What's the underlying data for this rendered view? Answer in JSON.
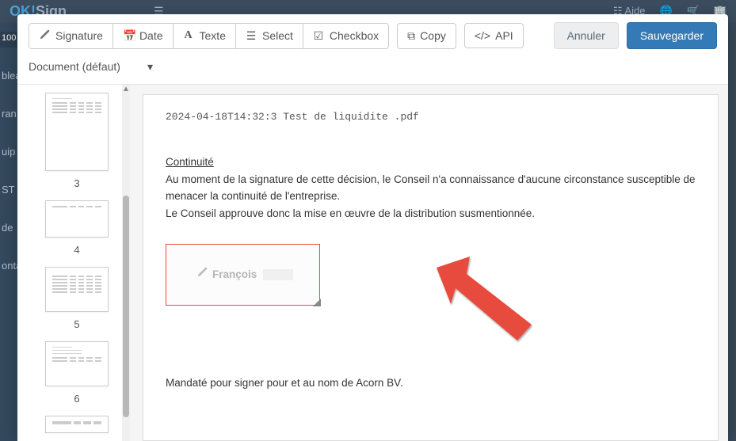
{
  "brand": {
    "ok": "OK!",
    "sign": "Sign"
  },
  "topbar": {
    "aide": "Aide"
  },
  "sidebar": {
    "zoom": "100",
    "items": [
      "blea",
      "ran",
      "uip",
      "ST",
      "de",
      "onta"
    ]
  },
  "toolbar": {
    "signature": "Signature",
    "date": "Date",
    "texte": "Texte",
    "select": "Select",
    "checkbox": "Checkbox",
    "copy": "Copy",
    "api": "API"
  },
  "actions": {
    "cancel": "Annuler",
    "save": "Sauvegarder"
  },
  "subbar": {
    "doc_select": "Document (défaut)"
  },
  "thumbs": {
    "p3": "3",
    "p4": "4",
    "p5": "5",
    "p6": "6"
  },
  "page": {
    "header": "2024-04-18T14:32:3 Test de liquidite .pdf",
    "section_title": "Continuité",
    "para1": "Au moment de la signature de cette décision, le Conseil n'a connaissance d'aucune circonstance susceptible de menacer la continuité de l'entreprise.",
    "para2": "Le Conseil approuve donc la mise en œuvre de la distribution susmentionnée.",
    "sig_name": "François",
    "mandate": "Mandaté pour signer pour et au nom de Acorn BV."
  }
}
